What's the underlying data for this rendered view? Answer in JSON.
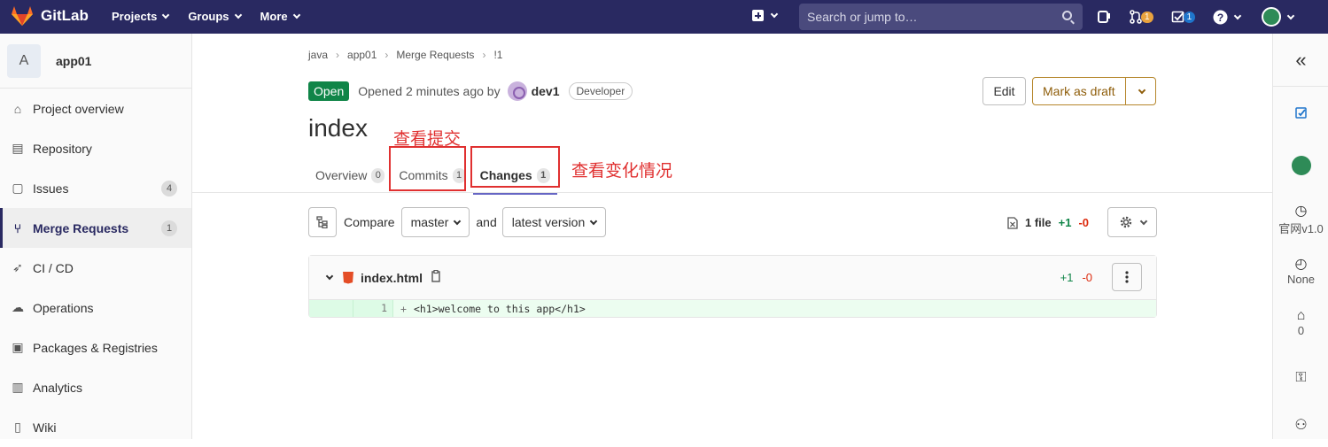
{
  "topbar": {
    "brand": "GitLab",
    "nav": [
      {
        "label": "Projects"
      },
      {
        "label": "Groups"
      },
      {
        "label": "More"
      }
    ],
    "search_placeholder": "Search or jump to…",
    "mr_badge": "1",
    "todo_badge": "1",
    "mr_badge_color": "#e9a33e",
    "todo_badge_color": "#1f75cb",
    "bar_color": "#292961"
  },
  "sidebar": {
    "project_initial": "A",
    "project_name": "app01",
    "items": [
      {
        "label": "Project overview",
        "icon": "home-icon"
      },
      {
        "label": "Repository",
        "icon": "doc-icon"
      },
      {
        "label": "Issues",
        "icon": "issues-icon",
        "count": "4"
      },
      {
        "label": "Merge Requests",
        "icon": "merge-icon",
        "count": "1"
      },
      {
        "label": "CI / CD",
        "icon": "rocket-icon"
      },
      {
        "label": "Operations",
        "icon": "cloud-icon"
      },
      {
        "label": "Packages & Registries",
        "icon": "package-icon"
      },
      {
        "label": "Analytics",
        "icon": "chart-icon"
      },
      {
        "label": "Wiki",
        "icon": "book-icon"
      }
    ]
  },
  "breadcrumb": [
    "java",
    "app01",
    "Merge Requests",
    "!1"
  ],
  "mr": {
    "status": "Open",
    "opened_text": "Opened 2 minutes ago by",
    "author": "dev1",
    "role": "Developer",
    "edit_label": "Edit",
    "draft_label": "Mark as draft",
    "title": "index"
  },
  "tabs": [
    {
      "label": "Overview",
      "count": "0"
    },
    {
      "label": "Commits",
      "count": "1"
    },
    {
      "label": "Changes",
      "count": "1"
    }
  ],
  "annotations": {
    "commits_note": "查看提交",
    "changes_note": "查看变化情况",
    "color": "#e03030"
  },
  "compare": {
    "label": "Compare",
    "source": "master",
    "and_label": "and",
    "target": "latest version",
    "file_count": "1 file",
    "additions": "+1",
    "deletions": "-0"
  },
  "diff": {
    "file_name": "index.html",
    "additions": "+1",
    "deletions": "-0",
    "lines": [
      {
        "new_line": "1",
        "sign": "+",
        "code": "<h1>welcome to this app</h1>"
      }
    ]
  },
  "rightbar": {
    "milestone": "官网v1.0",
    "time_tracking": "None",
    "labels_count": "0"
  }
}
